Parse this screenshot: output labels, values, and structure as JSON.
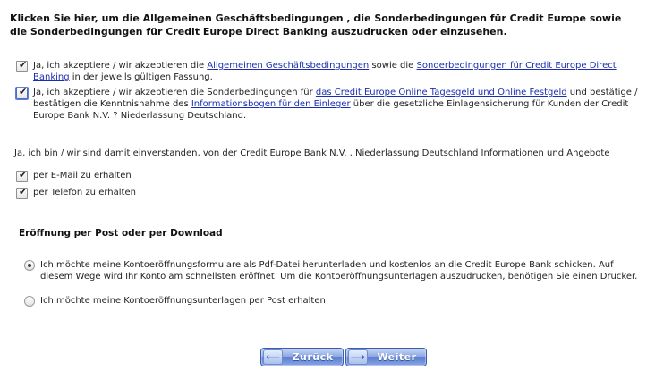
{
  "heading": "Klicken Sie hier, um die Allgemeinen Geschäftsbedingungen , die Sonderbedingungen für Credit Europe sowie die Sonderbedingungen für Credit Europe Direct Banking auszudrucken oder einzusehen.",
  "agreements": {
    "agb": {
      "checked": true,
      "text_1": "Ja, ich akzeptiere / wir akzeptieren die ",
      "link_1": "Allgemeinen Geschäftsbedingungen",
      "text_2": " sowie die ",
      "link_2": "Sonderbedingungen für Credit Europe Direct Banking",
      "text_3": " in der jeweils gültigen Fassung."
    },
    "sonder": {
      "checked": true,
      "text_1": "Ja, ich akzeptiere / wir akzeptieren die Sonderbedingungen für ",
      "link_1": "das Credit Europe Online Tagesgeld und Online Festgeld",
      "text_2": " und bestätige / bestätigen die Kenntnisnahme des ",
      "link_2": "Informationsbogen für den Einleger",
      "text_3": " über die gesetzliche Einlagensicherung für Kunden der Credit Europe Bank N.V. ? Niederlassung Deutschland."
    }
  },
  "consent": {
    "intro": "Ja, ich bin / wir sind damit einverstanden, von der Credit Europe Bank N.V. , Niederlassung Deutschland Informationen und Angebote",
    "email_label": "per E-Mail zu erhalten",
    "email_checked": true,
    "phone_label": "per Telefon zu erhalten",
    "phone_checked": true
  },
  "opening": {
    "title": "Eröffnung per Post oder per Download",
    "option_download": "Ich möchte meine Kontoeröffnungsformulare als Pdf-Datei herunterladen und kostenlos an die Credit Europe Bank schicken. Auf diesem Wege wird Ihr Konto am schnellsten eröffnet. Um die Kontoeröffnungsunterlagen auszudrucken, benötigen Sie einen Drucker.",
    "option_post": "Ich möchte meine Kontoeröffnungsunterlagen per Post erhalten.",
    "selected": "download"
  },
  "buttons": {
    "back_label": "Zurück",
    "next_label": "Weiter",
    "back_icon": "arrow-left-icon",
    "next_icon": "arrow-right-icon"
  },
  "icons": {
    "check_glyph": "✔",
    "arrow_left": "⟵",
    "arrow_right": "⟶"
  }
}
